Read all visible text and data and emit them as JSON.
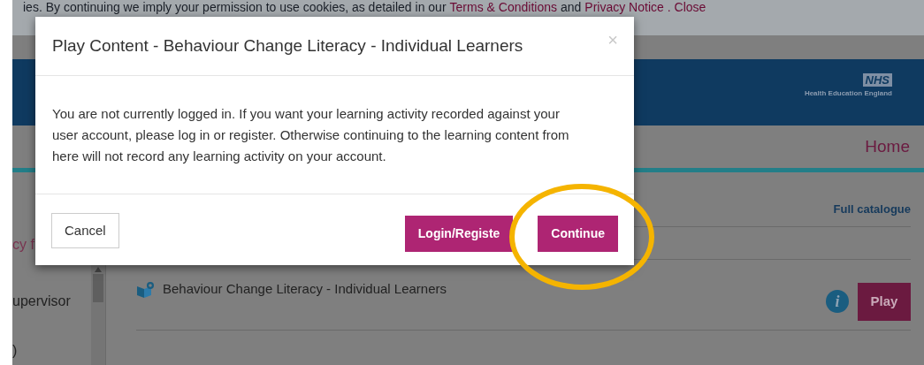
{
  "cookie_notice": [
    {
      "kind": "text",
      "text": "ies. By continuing we imply your permission to use cookies, as detailed in our"
    },
    {
      "kind": "link",
      "text": "Terms & Conditions"
    },
    {
      "kind": "text",
      "text": "and"
    },
    {
      "kind": "link",
      "text": "Privacy Notice"
    },
    {
      "kind": "link",
      "text": ". Close"
    }
  ],
  "header": {
    "logo": "NHS",
    "org": "Health Education England"
  },
  "nav": {
    "home": "Home"
  },
  "sidebar": {
    "items": [
      {
        "text": "cy f",
        "selected": true
      },
      {
        "text": "upervisor",
        "selected": false
      },
      {
        "text": ")",
        "selected": false
      }
    ]
  },
  "catalogue": {
    "link": "Full catalogue",
    "items": [
      {
        "title": "Behaviour Change Literacy - Individual Learners",
        "button": "Play",
        "info": "i"
      }
    ]
  },
  "dialog": {
    "title": "Play Content - Behaviour Change Literacy - Individual Learners",
    "close": "×",
    "message": "You are not currently logged in. If you want your learning activity recorded against your user account, please log in or register. Otherwise continuing to the learning content from here will not record any learning activity on your account.",
    "buttons": [
      {
        "label": "Cancel",
        "kind": "secondary"
      },
      {
        "label": "Login/Registe",
        "kind": "primary"
      },
      {
        "label": "Continue",
        "kind": "primary"
      }
    ],
    "highlighted": true
  }
}
